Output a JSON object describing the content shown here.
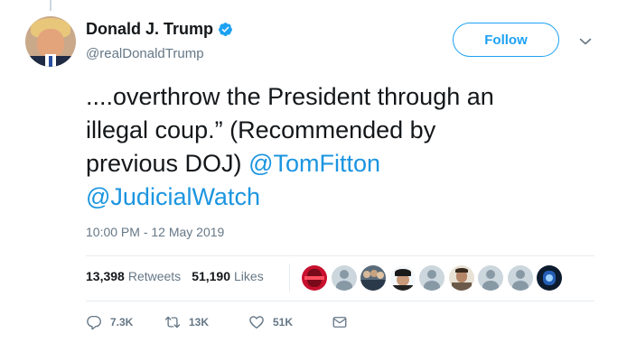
{
  "author": {
    "display_name": "Donald J. Trump",
    "handle": "@realDonaldTrump",
    "verified_icon": "verified-badge-icon",
    "avatar": "profile-photo"
  },
  "follow_label": "Follow",
  "tweet": {
    "line1": "....overthrow the President through an",
    "line2": "illegal coup.” (Recommended by",
    "line3_text": "previous DOJ) ",
    "mention1": "@TomFitton",
    "mention2": "@JudicialWatch"
  },
  "timestamp": "10:00 PM - 12 May 2019",
  "stats": {
    "retweets_count": "13,398",
    "retweets_label": "Retweets",
    "likes_count": "51,190",
    "likes_label": "Likes"
  },
  "liked_by_avatars": [
    "red-avatar",
    "default-avatar",
    "group-avatar",
    "cap-avatar",
    "default-avatar",
    "man-avatar",
    "default-avatar",
    "default-avatar",
    "dark-blue-avatar"
  ],
  "actions": {
    "reply_count": "7.3K",
    "retweet_count": "13K",
    "like_count": "51K"
  },
  "colors": {
    "link_blue": "#1b95e0",
    "button_blue": "#1da1f2",
    "muted_gray": "#657786",
    "text_black": "#14171a"
  }
}
